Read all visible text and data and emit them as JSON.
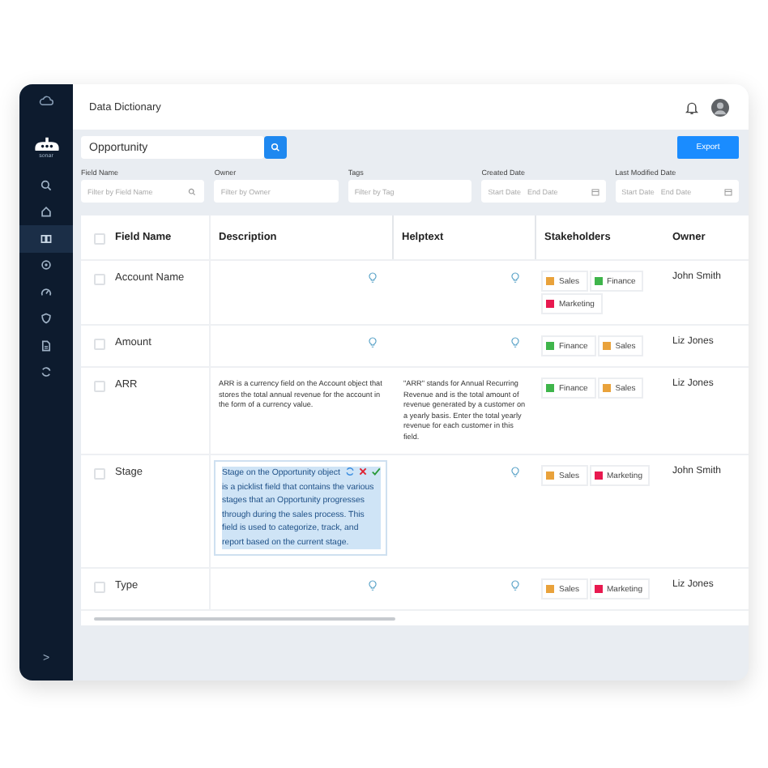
{
  "sidebar": {
    "logo_text": "sonar",
    "items": [
      {
        "selected": false
      },
      {
        "selected": false
      },
      {
        "selected": true
      },
      {
        "selected": false
      },
      {
        "selected": false
      },
      {
        "selected": false
      },
      {
        "selected": false
      },
      {
        "selected": false
      }
    ],
    "expand": ">"
  },
  "header": {
    "title": "Data Dictionary"
  },
  "search": {
    "value": "Opportunity"
  },
  "export_button": "Export",
  "filters": [
    {
      "label": "Field Name",
      "kind": "search",
      "placeholder": "Filter by Field Name"
    },
    {
      "label": "Owner",
      "kind": "text",
      "placeholder": "Filter by Owner"
    },
    {
      "label": "Tags",
      "kind": "text",
      "placeholder": "Filter by Tag"
    },
    {
      "label": "Created Date",
      "kind": "date",
      "start": "Start Date",
      "end": "End Date"
    },
    {
      "label": "Last Modified Date",
      "kind": "date",
      "start": "Start Date",
      "end": "End Date"
    }
  ],
  "table": {
    "header_checked": false,
    "columns": [
      "Field Name",
      "Description",
      "Helptext",
      "Stakeholders",
      "Owner"
    ],
    "rows": [
      {
        "checked": false,
        "name": "Account Name",
        "helptext": null,
        "stakeholders": [
          {
            "label": "Sales",
            "color": "#e9a23b"
          },
          {
            "label": "Finance",
            "color": "#3fb54b"
          },
          {
            "label": "Marketing",
            "color": "#e8194f"
          }
        ],
        "owner": "John Smith"
      },
      {
        "checked": false,
        "name": "Amount",
        "helptext": null,
        "stakeholders": [
          {
            "label": "Finance",
            "color": "#3fb54b"
          },
          {
            "label": "Sales",
            "color": "#e9a23b"
          }
        ],
        "owner": "Liz Jones"
      },
      {
        "checked": false,
        "name": "ARR",
        "description": {
          "kind": "plain",
          "text": "ARR is a currency field on the Account object that stores the total annual revenue for the account in the form of a currency value."
        },
        "helptext": "\"ARR\" stands for Annual Recurring Revenue and is the total amount of revenue generated by a customer on a yearly basis. Enter the total yearly revenue for each customer in this field.",
        "stakeholders": [
          {
            "label": "Finance",
            "color": "#3fb54b"
          },
          {
            "label": "Sales",
            "color": "#e9a23b"
          }
        ],
        "owner": "Liz Jones"
      },
      {
        "checked": false,
        "name": "Stage",
        "description": {
          "kind": "editing",
          "text": "Stage on the Opportunity object is a picklist field that contains the various stages that an Opportunity progresses through during the sales process. This field is used to categorize, track, and report based on the current stage."
        },
        "helptext": null,
        "stakeholders": [
          {
            "label": "Sales",
            "color": "#e9a23b"
          },
          {
            "label": "Marketing",
            "color": "#e8194f"
          }
        ],
        "owner": "John Smith"
      },
      {
        "checked": false,
        "name": "Type",
        "helptext": null,
        "stakeholders": [
          {
            "label": "Sales",
            "color": "#e9a23b"
          },
          {
            "label": "Marketing",
            "color": "#e8194f"
          }
        ],
        "owner": "Liz Jones"
      }
    ]
  }
}
